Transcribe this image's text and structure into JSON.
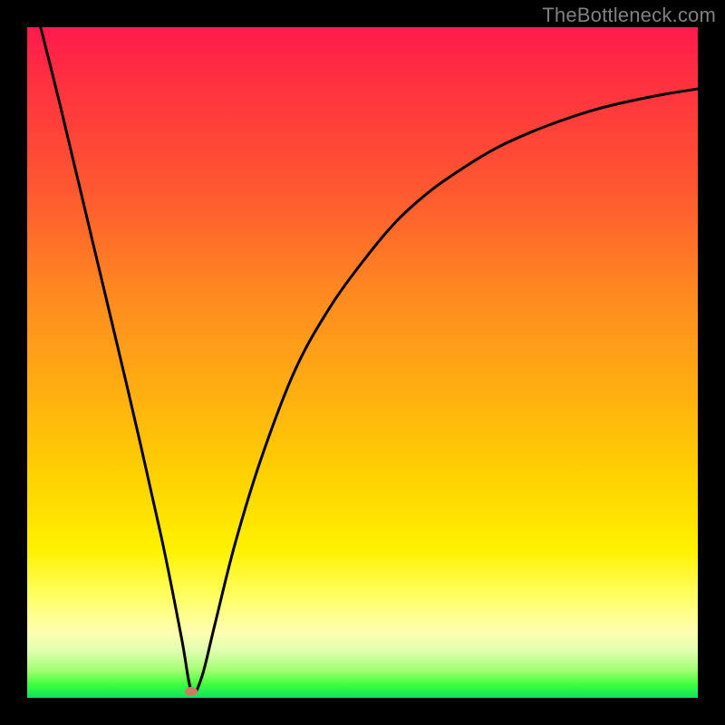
{
  "watermark": "TheBottleneck.com",
  "chart_data": {
    "type": "line",
    "title": "",
    "xlabel": "",
    "ylabel": "",
    "xlim": [
      0,
      100
    ],
    "ylim": [
      0,
      100
    ],
    "grid": false,
    "legend": false,
    "series": [
      {
        "name": "bottleneck-curve",
        "x": [
          2,
          5,
          10,
          15,
          20,
          23,
          24.5,
          26,
          28,
          31,
          35,
          40,
          45,
          50,
          55,
          60,
          65,
          70,
          75,
          80,
          85,
          90,
          95,
          100
        ],
        "values": [
          100,
          88,
          67,
          46,
          24,
          9,
          1,
          3,
          11,
          23,
          36,
          49,
          58,
          65,
          71,
          75.5,
          79,
          82,
          84.3,
          86.2,
          87.8,
          89,
          90,
          90.8
        ]
      }
    ],
    "annotations": [
      {
        "name": "minimum-marker",
        "x": 24.5,
        "y": 1,
        "color": "#cf7b62"
      }
    ],
    "background_gradient": {
      "direction": "vertical",
      "stops": [
        {
          "pos": 0.0,
          "color": "#ff1a4d"
        },
        {
          "pos": 0.25,
          "color": "#ff5a30"
        },
        {
          "pos": 0.55,
          "color": "#ffb010"
        },
        {
          "pos": 0.78,
          "color": "#fff200"
        },
        {
          "pos": 0.93,
          "color": "#e0ffb0"
        },
        {
          "pos": 1.0,
          "color": "#10e060"
        }
      ]
    }
  }
}
